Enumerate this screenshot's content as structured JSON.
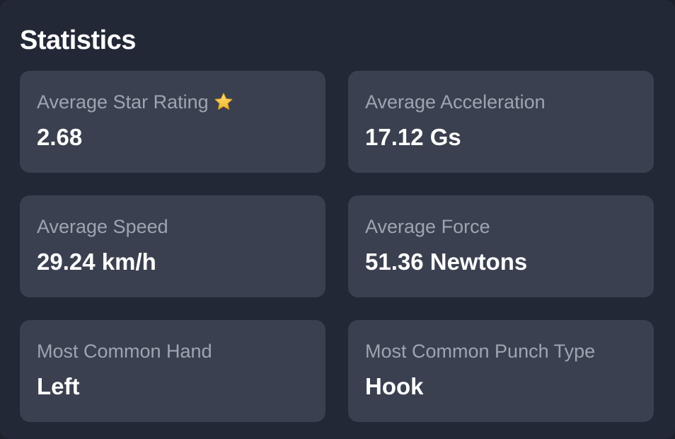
{
  "panel": {
    "title": "Statistics"
  },
  "stats": [
    {
      "label": "Average Star Rating",
      "icon": "star-icon",
      "value": "2.68"
    },
    {
      "label": "Average Acceleration",
      "value": "17.12 Gs"
    },
    {
      "label": "Average Speed",
      "value": "29.24 km/h"
    },
    {
      "label": "Average Force",
      "value": "51.36 Newtons"
    },
    {
      "label": "Most Common Hand",
      "value": "Left"
    },
    {
      "label": "Most Common Punch Type",
      "value": "Hook"
    }
  ],
  "colors": {
    "background": "#222836",
    "card": "#3a404f",
    "label": "#9ea4b0",
    "value": "#ffffff",
    "star": "#f5c542"
  }
}
